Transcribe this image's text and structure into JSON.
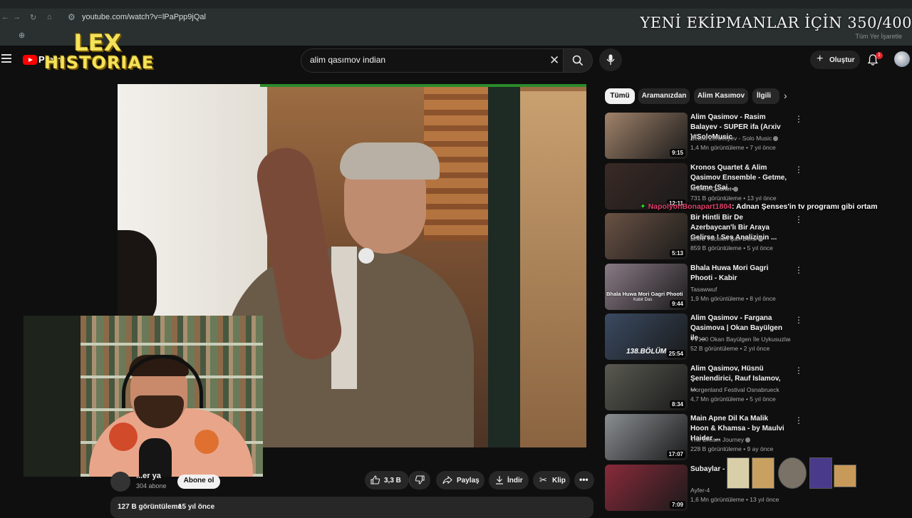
{
  "browser": {
    "url": "youtube.com/watch?v=lPaPpp9jQal",
    "bookmark_folder": "Tüm Yer İşaretle"
  },
  "overlay": {
    "banner": "YENİ EKİPMANLAR İÇİN 350/400",
    "logo_line1": "LEX",
    "logo_line2": "HISTORIAE"
  },
  "header": {
    "wordmark": "Premi",
    "search_value": "alim qasımov indian",
    "create_label": "Oluştur",
    "notification_count": "1"
  },
  "channel": {
    "name": "...er ya",
    "subscribers": "304 abone",
    "subscribe_label": "Abone ol"
  },
  "actions": {
    "likes": "3,3 B",
    "share": "Paylaş",
    "download": "İndir",
    "clip": "Klip"
  },
  "video_meta": {
    "views": "127 B görüntüleme",
    "date": "15 yıl önce"
  },
  "chips": [
    "Tümü",
    "Aramanızdan",
    "Alim Kasımov",
    "İlgili"
  ],
  "chat": {
    "user": "NapolyonBonapart1804",
    "message": ": Adnan Şenses'in tv programı gibi ortam"
  },
  "recommendations": [
    {
      "title": "Alim Qasimov - Rasim Balayev - SUPER ifa (Arxiv )#SoloMusic",
      "channel": "Sebail Zerbeliyev - Solo Music",
      "verified": true,
      "meta": "1,4 Mn görüntüleme • 7 yıl önce",
      "duration": "9:15",
      "color": "#a0826a"
    },
    {
      "title": "Kronos Quartet & Alim Qasimov Ensemble - Getme, Getme (Sai...",
      "channel": "Kronos Quartet",
      "verified": true,
      "meta": "731 B görüntüleme • 13 yıl önce",
      "duration": "12:11",
      "color": "#3a2a26"
    },
    {
      "title": "Bir Hintli Bir De Azerbaycan'lı Bir Araya Gelirse ! Ses Analizinin ...",
      "channel": "Emre Yücelen Şan Dersi",
      "verified": true,
      "meta": "859 B görüntüleme • 5 yıl önce",
      "duration": "5:13",
      "color": "#6a5244"
    },
    {
      "title": "Bhala Huwa Mori Gagri Phooti - Kabir",
      "channel": "Tasawwuf",
      "verified": false,
      "meta": "1,9 Mn görüntüleme • 8 yıl önce",
      "duration": "9:44",
      "color": "#8a7a86"
    },
    {
      "title": "Alim Qasimov - Fargana Qasimova | Okan Bayülgen ile ...",
      "channel": "TV100 Okan Bayülgen İle Uykusuzlar Kul...",
      "verified": false,
      "meta": "52 B görüntüleme • 2 yıl önce",
      "duration": "25:54",
      "color": "#3a4a62"
    },
    {
      "title": "Alim Qasimov, Hüsnü Şenlendirici, Rauf Islamov, ...",
      "channel": "Morgenland Festival Osnabrueck",
      "verified": false,
      "meta": "4,7 Mn görüntüleme • 5 yıl önce",
      "duration": "8:34",
      "color": "#5a5a52"
    },
    {
      "title": "Main Apne Dil Ka Malik Hoon & Khamsa - by Maulvi Haider ...",
      "channel": "The Dream Journey",
      "verified": true,
      "meta": "228 B görüntüleme • 9 ay önce",
      "duration": "17:07",
      "color": "#8a8e92"
    },
    {
      "title": "Subaylar - A...",
      "channel": "Ayfer-4",
      "verified": false,
      "meta": "1,6 Mn görüntüleme • 13 yıl önce",
      "duration": "7:09",
      "color": "#8a2a3a"
    }
  ],
  "thumbnail_texts": {
    "rec3": "Bhala Huwa Mori Gagri Phooti",
    "rec3_sub": "Kabir Das",
    "rec4": "138.BÖLÜM"
  }
}
